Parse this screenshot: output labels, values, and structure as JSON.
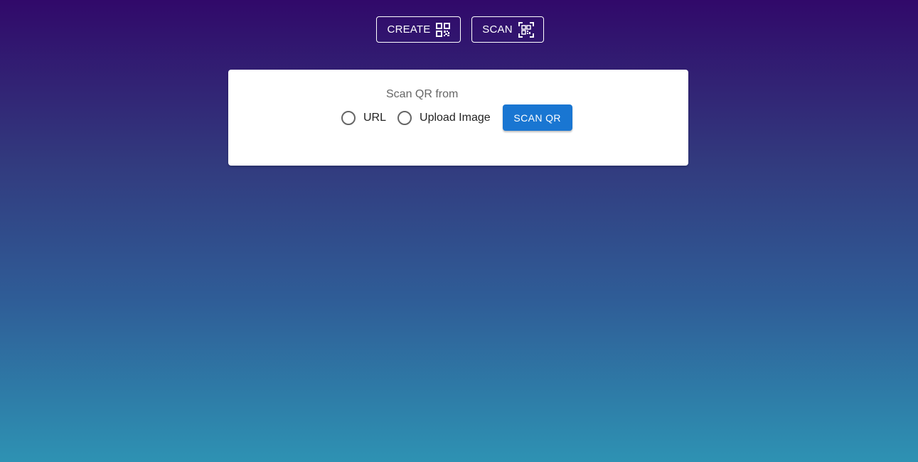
{
  "nav": {
    "create_label": "CREATE",
    "scan_label": "SCAN"
  },
  "card": {
    "title": "Scan QR from",
    "options": [
      {
        "label": "URL",
        "selected": false
      },
      {
        "label": "Upload Image",
        "selected": false
      }
    ],
    "scan_button_label": "SCAN QR"
  },
  "colors": {
    "accent": "#1976d2",
    "gradient_top": "#31096a",
    "gradient_bottom": "#2e92b3"
  },
  "icons": {
    "create": "qr-code-icon",
    "scan": "qr-scanner-icon"
  }
}
